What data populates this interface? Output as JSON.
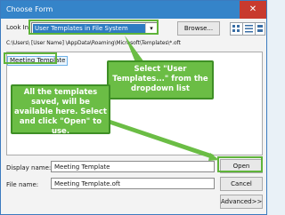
{
  "dialog": {
    "title": "Choose Form",
    "close_icon": "close-icon",
    "look_in_label": "Look In:",
    "look_in_value": "User Templates in File System",
    "browse_label": "Browse...",
    "path_text": "C:\\Users\\ [User Name]  \\AppData\\Roaming\\Microsoft\\Templates\\*.oft",
    "list_items": [
      "Meeting Template"
    ],
    "display_name_label": "Display name:",
    "display_name_value": "Meeting Template",
    "file_name_label": "File name:",
    "file_name_value": "Meeting Template.oft",
    "open_label": "Open",
    "cancel_label": "Cancel",
    "advanced_label": "Advanced>>"
  },
  "callouts": {
    "select_user_templates": "Select \"User Templates...\" from the dropdown list",
    "templates_available": "All the templates saved, will be available here. Select and click \"Open\" to use."
  },
  "colors": {
    "titlebar": "#3584c9",
    "selection": "#2f7cc2",
    "callout": "#6bbd45",
    "close": "#c83a2e"
  }
}
